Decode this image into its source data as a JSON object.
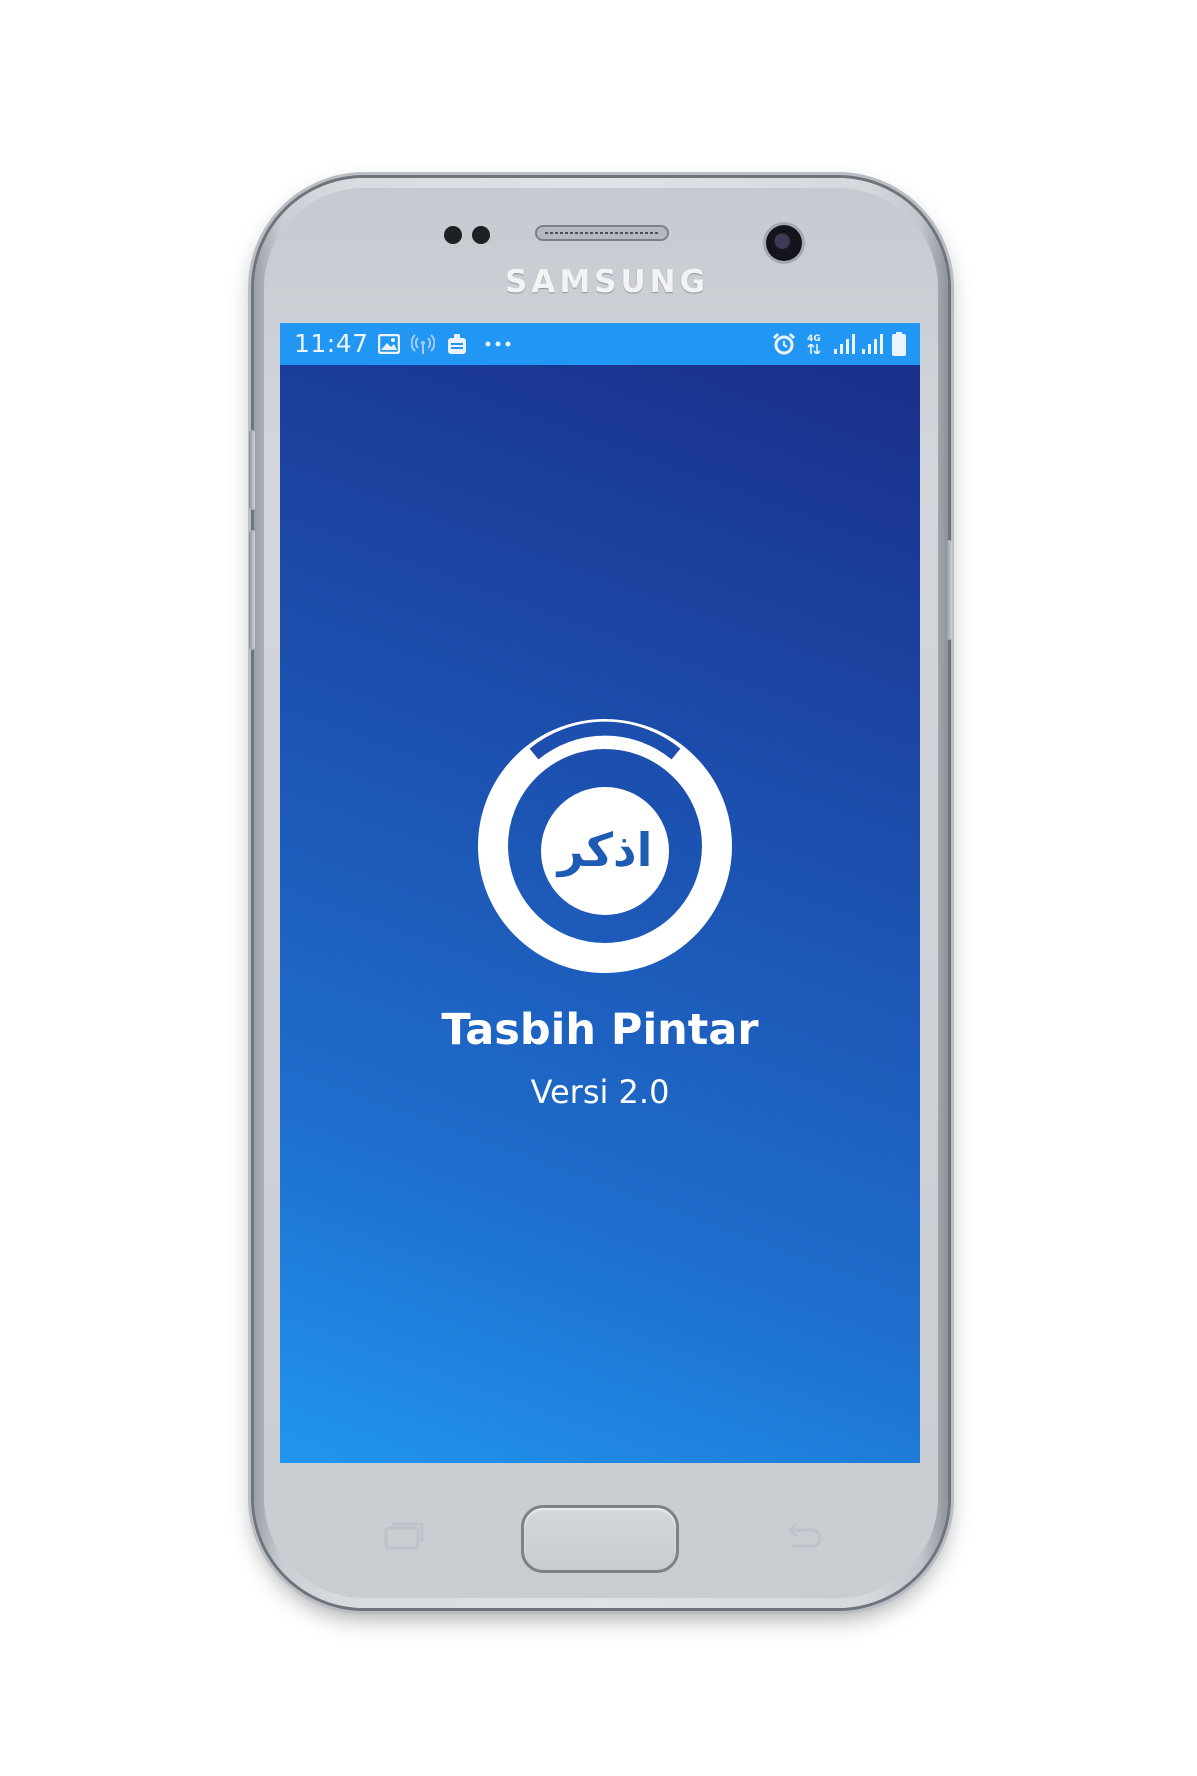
{
  "device": {
    "brand": "SAMSUNG"
  },
  "status_bar": {
    "time": "11:47",
    "left_icons": [
      "gallery-icon",
      "hotspot-icon",
      "app-notification-icon",
      "more-dots-icon"
    ],
    "right_icons": [
      "alarm-icon",
      "4g-icon",
      "signal-1-icon",
      "signal-2-icon",
      "battery-icon"
    ],
    "network": "4G"
  },
  "splash": {
    "logo_text": "اذكر",
    "app_name": "Tasbih Pintar",
    "version": "Versi 2.0"
  },
  "nav_keys": [
    "recent-apps-icon",
    "home-button",
    "back-icon"
  ],
  "colors": {
    "status_bar": "#2196f3",
    "gradient_top": "#1a2c86",
    "gradient_bottom": "#2196ef",
    "logo": "#ffffff",
    "logo_text": "#1e5bb4"
  }
}
